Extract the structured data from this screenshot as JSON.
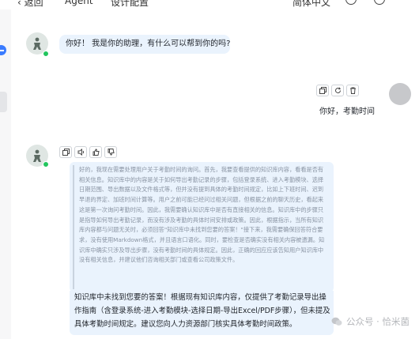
{
  "topbar": {
    "back_label": "返回",
    "agent_label": "Agent",
    "settings_label": "设计配置",
    "lang_label": "简体中文"
  },
  "messages": {
    "bot_greeting": "你好！ 我是你的助理，有什么可以帮到你的吗?",
    "user_question": "你好，考勤时间",
    "reasoning": "好的，我现在需要处理用户关于考勤时间的询问。首先，我要查看提供的知识库内容，看看是否有相关信息。知识库中的内容是关于如何导出考勤记录的步骤，包括登录系统、进入考勤模块、选择日期范围、导出数据以及文件格式等，但并没有提到具体的考勤时间规定，比如上下班时间、迟到早退的界定、加班时间计算等。用户之前可能已经问过相关问题，但根据之前的聊天历史，看起来这是第一次询问考勤时间。因此，我需要确认知识库中是否有直接相关的信息。知识库中的步骤只是指导如何导出考勤记录，而没有涉及考勤的具体时间安排或政策。因此，根据指示，当所有知识库内容都与问题无关时，必须回答\"知识库中未找到您要的答案！\"接下来，我需要确保回答符合要求，没有使用Markdown格式，并且语言口语化。同时，要检查是否确实没有相关内容被遗漏。知识库中确实只涉及导出步骤，没有考勤时间的具体规定。因此，正确的回应应该告知用户知识库中没有相关信息，并建议他们咨询相关部门或查看公司政策文件。",
    "answer": "知识库中未找到您要的答案！根据现有知识库内容，仅提供了考勤记录导出操作指南（含登录系统-进入考勤模块-选择日期-导出Excel/PDF步骤），但未提及具体考勤时间规定。建议您向人力资源部门核实具体考勤时间政策。"
  },
  "watermark": {
    "label": "公众号 · 恰米菌"
  },
  "colors": {
    "bubble": "#eaf3fd",
    "accent": "#3b7cff",
    "online": "#22c55e"
  }
}
